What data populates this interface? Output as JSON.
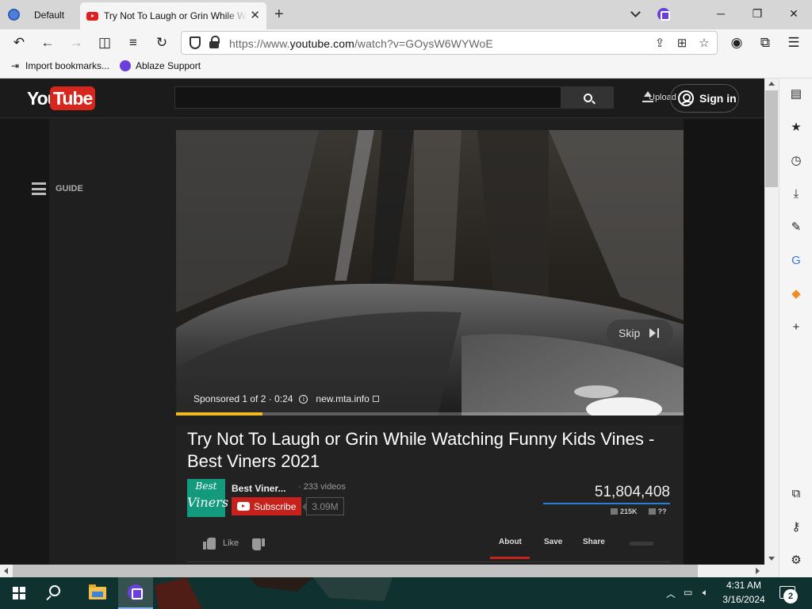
{
  "browser": {
    "profile_tab": "Default",
    "active_tab_title": "Try Not To Laugh or Grin While Watching Funny Kids Vines - Best Viners 2021",
    "url_prefix": "https://www.",
    "url_host": "youtube.com",
    "url_path": "/watch?v=GOysW6WYWoE",
    "bookmarks": [
      "Import bookmarks...",
      "Ablaze Support"
    ]
  },
  "youtube": {
    "logo_you": "You",
    "logo_tube": "Tube",
    "search_value": "",
    "upload_label": "Upload",
    "signin_label": "Sign in",
    "guide_label": "GUIDE"
  },
  "player": {
    "skip_label": "Skip",
    "sponsor_text": "Sponsored 1 of 2 · 0:24",
    "ad_domain": "new.mta.info",
    "progress_fraction": 0.17
  },
  "video": {
    "title": "Try Not To Laugh or Grin While Watching Funny Kids Vines - Best Viners 2021",
    "channel_name": "Best Viner...",
    "channel_videos": "· 233 videos",
    "channel_thumb_line1": "Best",
    "channel_thumb_line2": "Viners",
    "subscribe_label": "Subscribe",
    "subscriber_count": "3.09M",
    "views": "51,804,408",
    "likes": "215K",
    "dislikes": "??",
    "like_label": "Like",
    "tabs": [
      "About",
      "Save",
      "Share"
    ]
  },
  "taskbar": {
    "time": "4:31 AM",
    "date": "3/16/2024",
    "notification_count": "2"
  },
  "colors": {
    "accent_red": "#c6221b",
    "progress_yellow": "#f2b81f",
    "views_bar_blue": "#2a7fd4",
    "ablaze_purple": "#6b3fd9"
  }
}
